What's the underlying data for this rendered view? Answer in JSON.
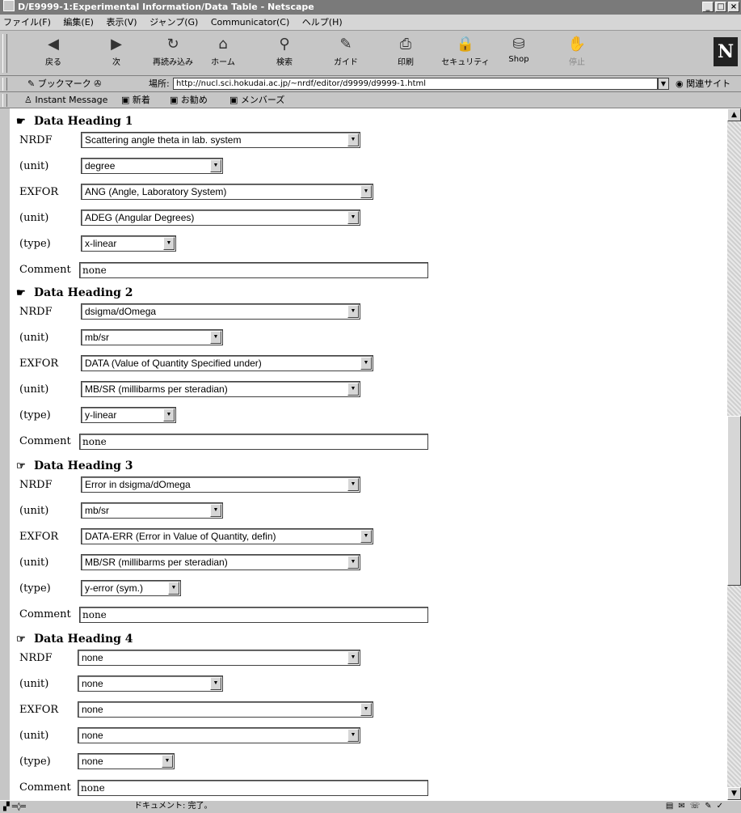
{
  "window": {
    "title": "D/E9999-1:Experimental Information/Data Table - Netscape",
    "minimize": "_",
    "restore": "□",
    "close": "×"
  },
  "menu": [
    "ファイル(F)",
    "編集(E)",
    "表示(V)",
    "ジャンプ(G)",
    "Communicator(C)",
    "ヘルプ(H)"
  ],
  "toolbar": [
    {
      "label": "戻る",
      "icon": "back-arrow-icon",
      "glyph": "◀"
    },
    {
      "label": "次",
      "icon": "forward-arrow-icon",
      "glyph": "▶"
    },
    {
      "label": "再読み込み",
      "icon": "reload-icon",
      "glyph": "↻"
    },
    {
      "label": "ホーム",
      "icon": "home-icon",
      "glyph": "⌂"
    },
    {
      "label": "検索",
      "icon": "search-icon",
      "glyph": "⚲"
    },
    {
      "label": "ガイド",
      "icon": "guide-icon",
      "glyph": "✎"
    },
    {
      "label": "印刷",
      "icon": "print-icon",
      "glyph": "⎙"
    },
    {
      "label": "セキュリティ",
      "icon": "lock-icon",
      "glyph": "🔒"
    },
    {
      "label": "Shop",
      "icon": "shop-icon",
      "glyph": "⛁"
    },
    {
      "label": "停止",
      "icon": "stop-icon",
      "glyph": "✋"
    }
  ],
  "brand": "N",
  "location": {
    "bookmarks_label": "ブックマーク",
    "label": "場所:",
    "url": "http://nucl.sci.hokudai.ac.jp/~nrdf/editor/d9999/d9999-1.html",
    "related": "関連サイト"
  },
  "personal": {
    "items": [
      "Instant Message",
      "新着",
      "お勧め",
      "メンバーズ"
    ]
  },
  "labels": {
    "nrdf": "NRDF",
    "unit": "(unit)",
    "exfor": "EXFOR",
    "type": "(type)",
    "comment": "Comment"
  },
  "sections": [
    {
      "heading": "Data Heading 1",
      "nrdf": "Scattering angle theta in lab. system",
      "nrdf_unit": "degree",
      "exfor": "ANG (Angle, Laboratory System)",
      "exfor_unit": "ADEG (Angular Degrees)",
      "type": "x-linear",
      "comment": "none"
    },
    {
      "heading": "Data Heading 2",
      "nrdf": "dsigma/dOmega",
      "nrdf_unit": "mb/sr",
      "exfor": "DATA (Value of Quantity Specified under)",
      "exfor_unit": "MB/SR (millibarms per steradian)",
      "type": "y-linear",
      "comment": "none"
    },
    {
      "heading": "Data Heading 3",
      "nrdf": "Error in dsigma/dOmega",
      "nrdf_unit": "mb/sr",
      "exfor": "DATA-ERR (Error in Value of Quantity, defin)",
      "exfor_unit": "MB/SR (millibarms per steradian)",
      "type": "y-error (sym.)",
      "comment": "none"
    },
    {
      "heading": "Data Heading 4",
      "nrdf": "none",
      "nrdf_unit": "none",
      "exfor": "none",
      "exfor_unit": "none",
      "type": "none",
      "comment": "none"
    }
  ],
  "status": {
    "text": "ドキュメント: 完了。"
  }
}
